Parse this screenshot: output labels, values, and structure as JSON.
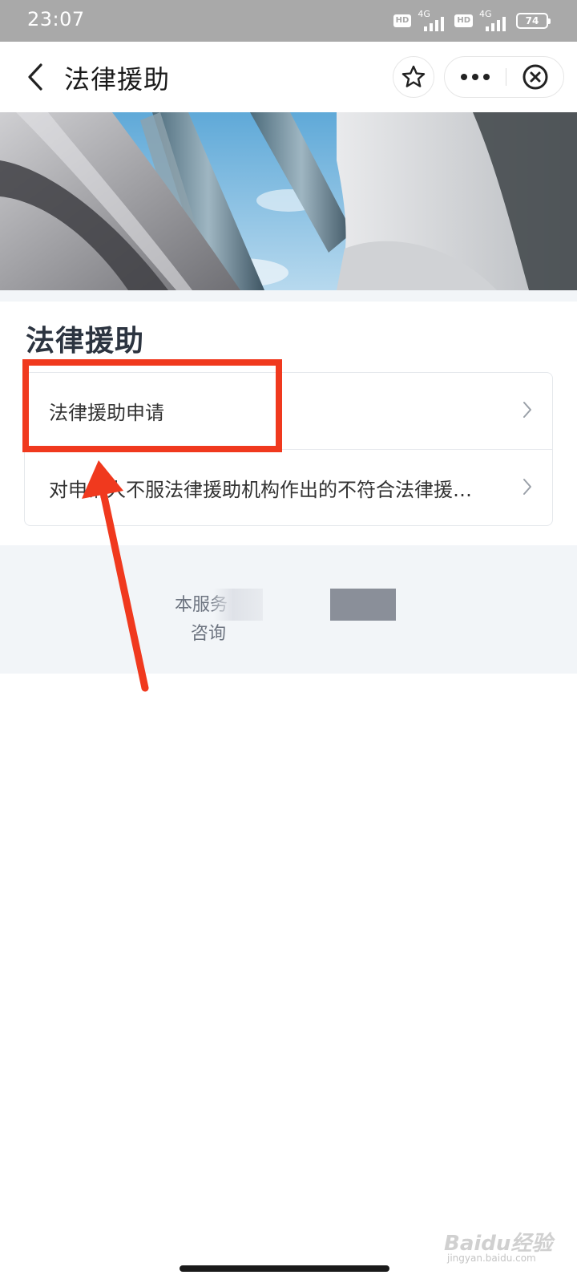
{
  "status_bar": {
    "time": "23:07",
    "hd_badge": "HD",
    "network_1": "4G",
    "network_2": "4G",
    "battery": "74"
  },
  "header": {
    "title": "法律援助",
    "back_icon": "chevron-left-icon",
    "favorite_icon": "star-icon",
    "more_icon": "more-dots-icon",
    "close_icon": "close-circle-icon"
  },
  "section": {
    "title": "法律援助",
    "items": [
      {
        "label": "法律援助申请",
        "icon": "chevron-right-icon"
      },
      {
        "label": "对申请人不服法律援助机构作出的不符合法律援…",
        "icon": "chevron-right-icon"
      }
    ]
  },
  "footer": {
    "line1": "本服务",
    "line2": "咨询"
  },
  "annotation": {
    "color": "#f0391e"
  },
  "watermark": {
    "brand": "Baidu经验",
    "url": "jingyan.baidu.com"
  }
}
